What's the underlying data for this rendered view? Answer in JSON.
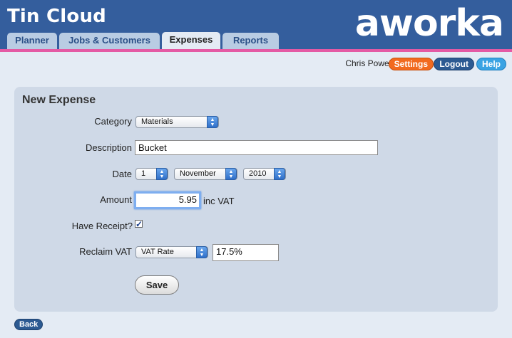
{
  "app": {
    "title": "Tin Cloud",
    "logo": "aworka"
  },
  "tabs": [
    {
      "label": "Planner"
    },
    {
      "label": "Jobs & Customers"
    },
    {
      "label": "Expenses"
    },
    {
      "label": "Reports"
    }
  ],
  "user": {
    "name": "Chris Powell",
    "settings_label": "Settings",
    "logout_label": "Logout",
    "help_label": "Help"
  },
  "form": {
    "title": "New Expense",
    "category": {
      "label": "Category",
      "value": "Materials"
    },
    "description": {
      "label": "Description",
      "value": "Bucket"
    },
    "date": {
      "label": "Date",
      "day": "1",
      "month": "November",
      "year": "2010"
    },
    "amount": {
      "label": "Amount",
      "value": "5.95",
      "suffix": "inc VAT"
    },
    "receipt": {
      "label": "Have Receipt?",
      "checked": true,
      "mark": "✓"
    },
    "reclaim": {
      "label": "Reclaim VAT",
      "option": "VAT Rate",
      "rate": "17.5%"
    },
    "save_label": "Save"
  },
  "footer": {
    "back_label": "Back"
  },
  "colors": {
    "header": "#345e9d",
    "accent_rule": "#e45aa4",
    "settings": "#f26a1f",
    "logout": "#2c5a92",
    "help": "#3aa3e3",
    "panel": "#cfd9e7"
  },
  "icons": {
    "select_arrow": "chevron-updown-icon",
    "checkbox": "checkmark-icon"
  }
}
